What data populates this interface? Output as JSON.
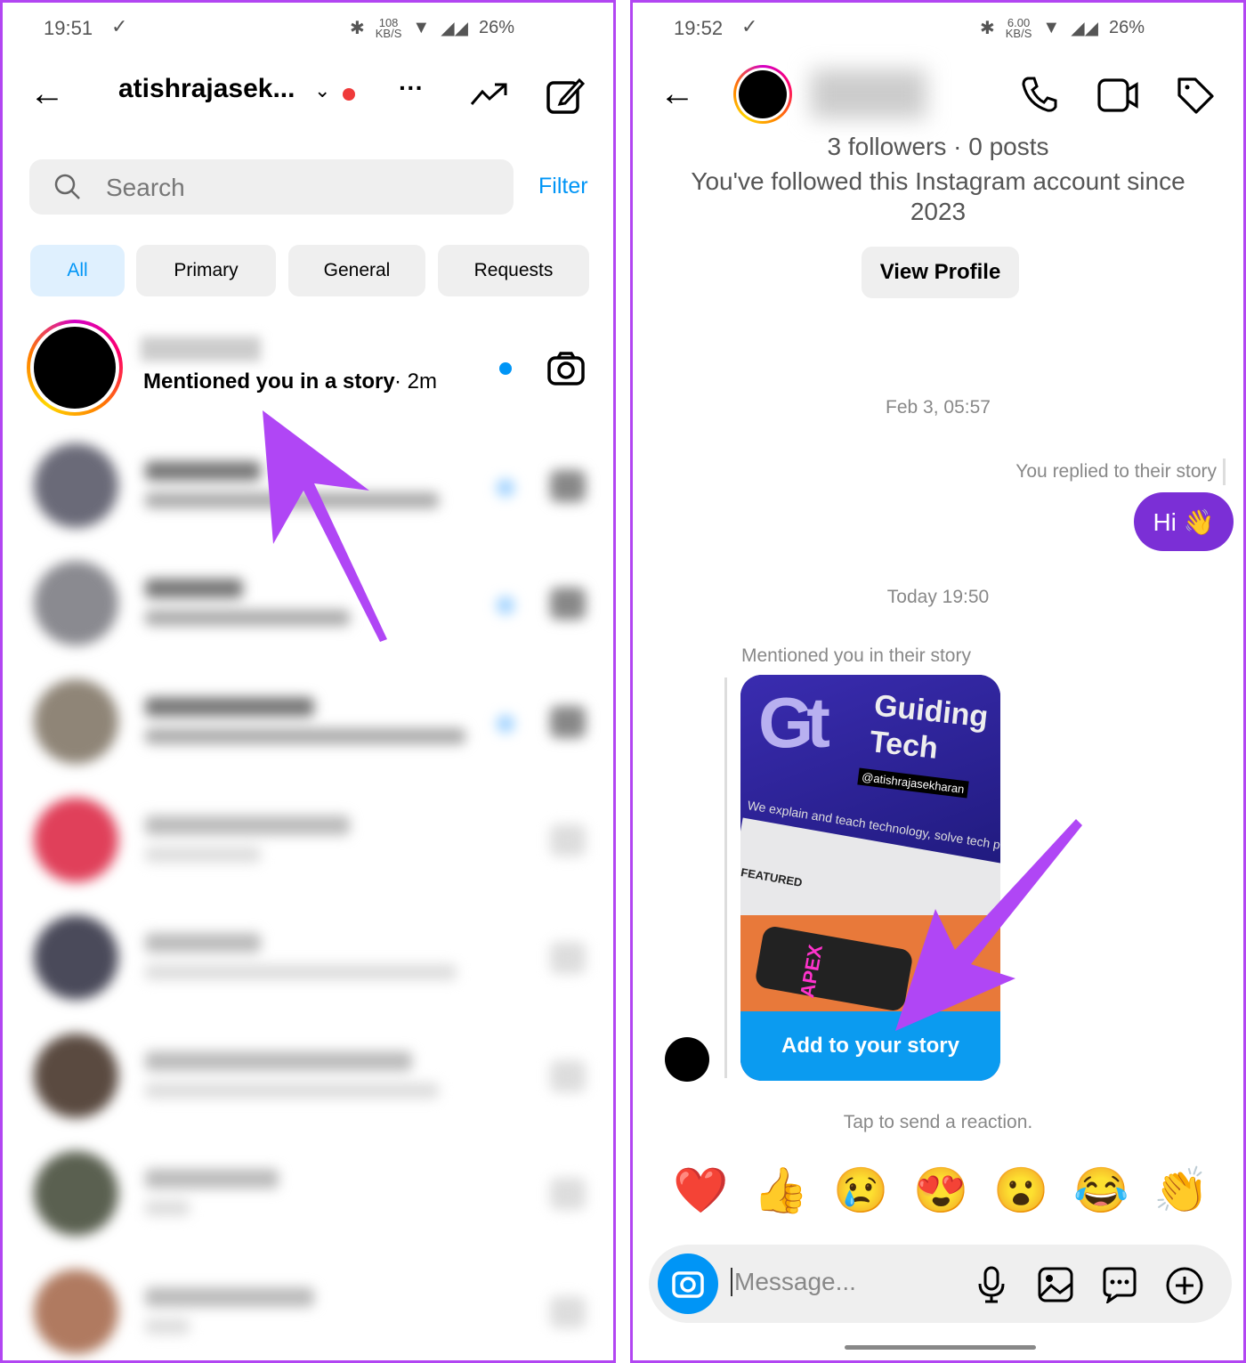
{
  "left": {
    "status": {
      "time": "19:51",
      "speed": "108",
      "speed_unit": "KB/S",
      "battery": "26%"
    },
    "header": {
      "username": "atishrajasek..."
    },
    "search": {
      "placeholder": "Search",
      "filter": "Filter"
    },
    "tabs": [
      {
        "label": "All",
        "active": true
      },
      {
        "label": "Primary"
      },
      {
        "label": "General"
      },
      {
        "label": "Requests"
      }
    ],
    "first_chat": {
      "message": "Mentioned you in a story",
      "time": "· 2m"
    }
  },
  "right": {
    "status": {
      "time": "19:52",
      "speed": "6.00",
      "speed_unit": "KB/S",
      "battery": "26%"
    },
    "profile": {
      "stats": "3 followers · 0 posts",
      "followed_since": "You've followed this Instagram account since 2023",
      "view_profile": "View Profile"
    },
    "messages": {
      "date1": "Feb 3, 05:57",
      "reply_note": "You replied to their story",
      "hi": "Hi 👋",
      "date2": "Today 19:50",
      "mention_note": "Mentioned you in their story",
      "story": {
        "brand1": "Guiding",
        "brand2": "Tech",
        "handle": "@atishrajasekharan",
        "tagline": "We explain and teach technology, solve tech prob",
        "featured": "FEATURED",
        "game": "APEX"
      },
      "add_story": "Add to your story"
    },
    "reaction_prompt": "Tap to send a reaction.",
    "reactions": [
      "❤️",
      "👍",
      "😢",
      "😍",
      "😮",
      "😂",
      "👏"
    ],
    "composer": {
      "placeholder": "Message..."
    }
  },
  "colors": {
    "accent": "#0095f6",
    "bubble": "#7b2fd6",
    "annotation_arrow": "#b046f5",
    "border": "#b246f2"
  }
}
